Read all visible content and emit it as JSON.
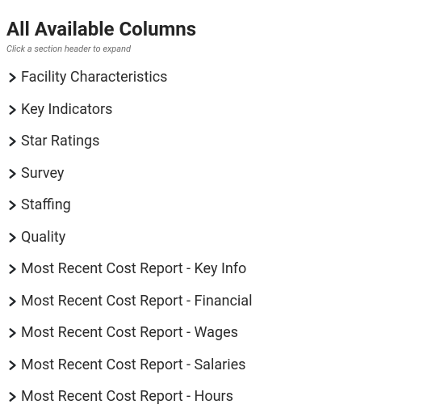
{
  "header": {
    "title": "All Available Columns",
    "subtitle": "Click a section header to expand"
  },
  "sections": [
    {
      "label": "Facility Characteristics"
    },
    {
      "label": "Key Indicators"
    },
    {
      "label": "Star Ratings"
    },
    {
      "label": "Survey"
    },
    {
      "label": "Staffing"
    },
    {
      "label": "Quality"
    },
    {
      "label": "Most Recent Cost Report - Key Info"
    },
    {
      "label": "Most Recent Cost Report - Financial"
    },
    {
      "label": "Most Recent Cost Report - Wages"
    },
    {
      "label": "Most Recent Cost Report - Salaries"
    },
    {
      "label": "Most Recent Cost Report - Hours"
    }
  ]
}
